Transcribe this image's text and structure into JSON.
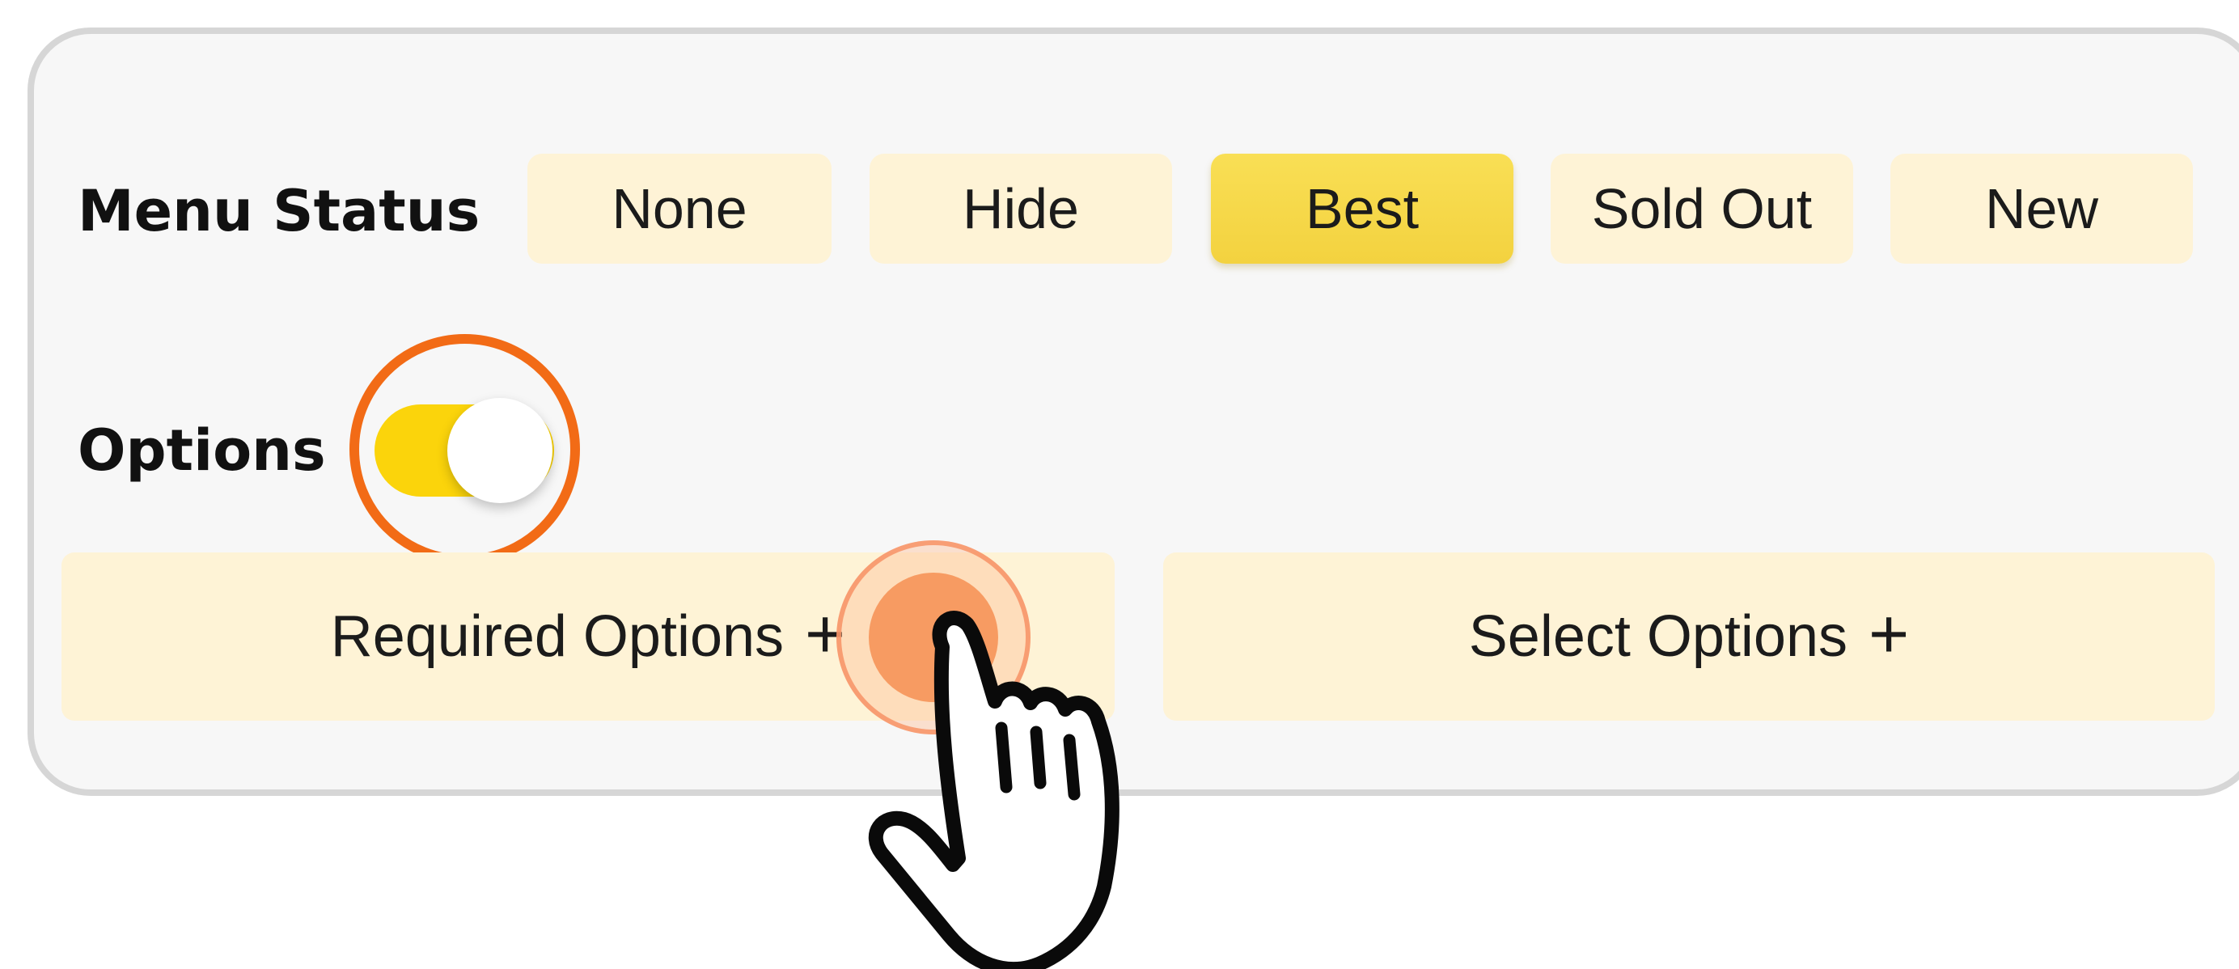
{
  "menu_status": {
    "label": "Menu Status",
    "buttons": [
      {
        "label": "None",
        "selected": false
      },
      {
        "label": "Hide",
        "selected": false
      },
      {
        "label": "Best",
        "selected": true
      },
      {
        "label": "Sold Out",
        "selected": false
      },
      {
        "label": "New",
        "selected": false
      }
    ]
  },
  "options": {
    "label": "Options",
    "toggle_on": true,
    "required_label": "Required Options",
    "select_label": "Select Options"
  },
  "icons": {
    "plus": "plus-icon",
    "pointer": "hand-pointer-icon",
    "tap": "tap-indicator-icon"
  },
  "colors": {
    "accent": "#fbd40b",
    "selected_button": "#f4d64c",
    "button_bg": "#fef3d6",
    "highlight_ring": "#f26b16",
    "tap": "#f79b62"
  }
}
